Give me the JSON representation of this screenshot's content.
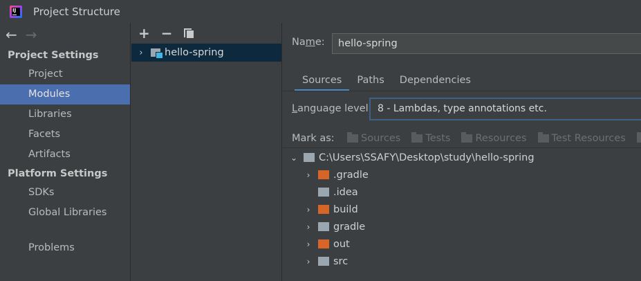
{
  "window": {
    "title": "Project Structure"
  },
  "nav": {
    "back_icon": "←",
    "forward_icon": "→"
  },
  "sidebar": {
    "project_settings_header": "Project Settings",
    "project_items": [
      {
        "label": "Project"
      },
      {
        "label": "Modules",
        "selected": true
      },
      {
        "label": "Libraries"
      },
      {
        "label": "Facets"
      },
      {
        "label": "Artifacts"
      }
    ],
    "platform_settings_header": "Platform Settings",
    "platform_items": [
      {
        "label": "SDKs"
      },
      {
        "label": "Global Libraries"
      }
    ],
    "problems_label": "Problems"
  },
  "module_toolbar": {
    "add_icon": "+",
    "remove_icon": "−"
  },
  "module_tree": {
    "module_name": "hello-spring",
    "chevron": "›"
  },
  "details": {
    "name_label_pre": "Na",
    "name_label_mnemonic": "m",
    "name_label_post": "e:",
    "name_value": "hello-spring",
    "tabs": [
      {
        "label": "Sources",
        "active": true
      },
      {
        "label": "Paths"
      },
      {
        "label": "Dependencies"
      }
    ],
    "language_label_mnemonic": "L",
    "language_label_rest": "anguage level:",
    "language_value": "8 - Lambdas, type annotations etc.",
    "mark_as_label": "Mark as:",
    "mark_buttons": [
      {
        "label": "Sources"
      },
      {
        "label": "Tests"
      },
      {
        "label": "Resources"
      },
      {
        "label": "Test Resources"
      }
    ],
    "root_path": "C:\\Users\\SSAFY\\Desktop\\study\\hello-spring",
    "folders": [
      {
        "name": ".gradle",
        "color": "orange",
        "expandable": true
      },
      {
        "name": ".idea",
        "color": "gray",
        "expandable": false
      },
      {
        "name": "build",
        "color": "orange",
        "expandable": true
      },
      {
        "name": "gradle",
        "color": "gray",
        "expandable": true
      },
      {
        "name": "out",
        "color": "orange",
        "expandable": true
      },
      {
        "name": "src",
        "color": "gray",
        "expandable": true
      }
    ]
  },
  "colors": {
    "selection": "#4b6eaf",
    "module_row": "#0d293e",
    "excluded_folder": "#d56628",
    "folder": "#9aa7b0",
    "tab_underline": "#4a88c7"
  }
}
